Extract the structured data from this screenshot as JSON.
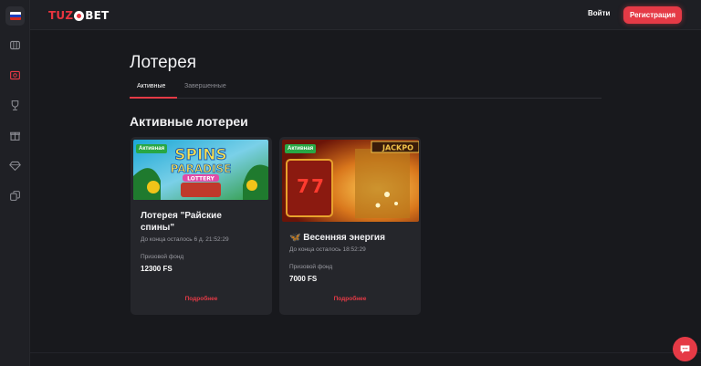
{
  "brand": {
    "part1": "TUZ",
    "part2": "BET"
  },
  "header": {
    "login_label": "Войти",
    "register_label": "Регистрация"
  },
  "sidebar": {
    "items": [
      {
        "icon": "russia-flag-icon"
      },
      {
        "icon": "slots-icon"
      },
      {
        "icon": "lottery-ticket-icon"
      },
      {
        "icon": "trophy-icon"
      },
      {
        "icon": "gift-icon"
      },
      {
        "icon": "diamond-icon"
      },
      {
        "icon": "cards-icon"
      }
    ]
  },
  "page": {
    "title": "Лотерея",
    "tabs": [
      {
        "label": "Активные",
        "active": true
      },
      {
        "label": "Завершенные",
        "active": false
      }
    ],
    "section_title": "Активные лотереи"
  },
  "lotteries": [
    {
      "badge": "Активная",
      "name": "Лотерея \"Райские спины\"",
      "image_text": {
        "line1": "SPINS",
        "line2": "PARADISE",
        "line3": "LOTTERY"
      },
      "timer": "До конца осталось 6 д. 21:52:29",
      "fund_label": "Призовой фонд",
      "fund_value": "12300 FS",
      "more_label": "Подробнее"
    },
    {
      "badge": "Активная",
      "name": "🦋 Весенняя энергия",
      "image_text": {
        "line1": "JACKPO"
      },
      "timer": "До конца осталось 18:52:29",
      "fund_label": "Призовой фонд",
      "fund_value": "7000 FS",
      "more_label": "Подробнее"
    }
  ],
  "colors": {
    "accent": "#e53a46",
    "active_badge": "#28a745",
    "background": "#18191d",
    "card": "#25262b"
  }
}
